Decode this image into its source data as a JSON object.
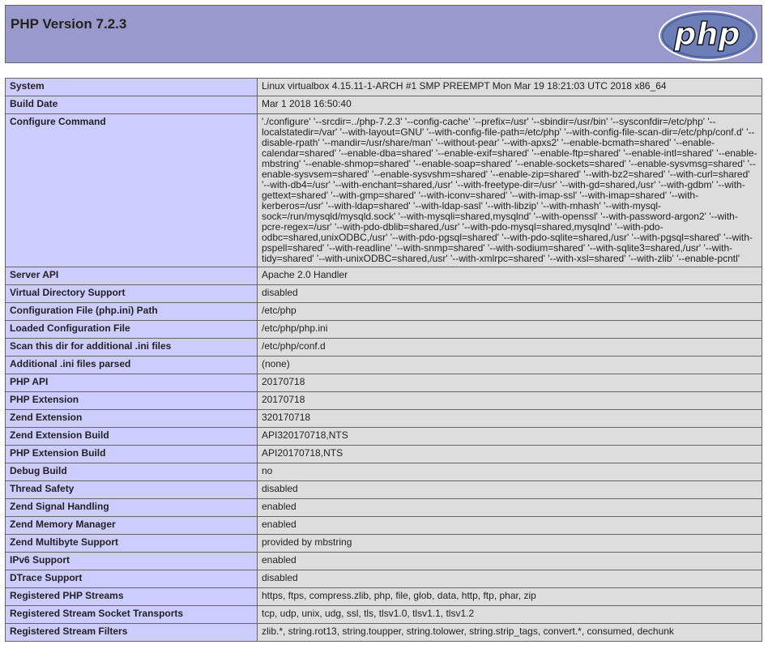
{
  "header": {
    "title": "PHP Version 7.2.3",
    "logo_text": "php"
  },
  "rows": [
    {
      "key": "System",
      "value": "Linux virtualbox 4.15.11-1-ARCH #1 SMP PREEMPT Mon Mar 19 18:21:03 UTC 2018 x86_64"
    },
    {
      "key": "Build Date",
      "value": "Mar 1 2018 16:50:40"
    },
    {
      "key": "Configure Command",
      "value": "'./configure' '--srcdir=../php-7.2.3' '--config-cache' '--prefix=/usr' '--sbindir=/usr/bin' '--sysconfdir=/etc/php' '--localstatedir=/var' '--with-layout=GNU' '--with-config-file-path=/etc/php' '--with-config-file-scan-dir=/etc/php/conf.d' '--disable-rpath' '--mandir=/usr/share/man' '--without-pear' '--with-apxs2' '--enable-bcmath=shared' '--enable-calendar=shared' '--enable-dba=shared' '--enable-exif=shared' '--enable-ftp=shared' '--enable-intl=shared' '--enable-mbstring' '--enable-shmop=shared' '--enable-soap=shared' '--enable-sockets=shared' '--enable-sysvmsg=shared' '--enable-sysvsem=shared' '--enable-sysvshm=shared' '--enable-zip=shared' '--with-bz2=shared' '--with-curl=shared' '--with-db4=/usr' '--with-enchant=shared,/usr' '--with-freetype-dir=/usr' '--with-gd=shared,/usr' '--with-gdbm' '--with-gettext=shared' '--with-gmp=shared' '--with-iconv=shared' '--with-imap-ssl' '--with-imap=shared' '--with-kerberos=/usr' '--with-ldap=shared' '--with-ldap-sasl' '--with-libzip' '--with-mhash' '--with-mysql-sock=/run/mysqld/mysqld.sock' '--with-mysqli=shared,mysqlnd' '--with-openssl' '--with-password-argon2' '--with-pcre-regex=/usr' '--with-pdo-dblib=shared,/usr' '--with-pdo-mysql=shared,mysqlnd' '--with-pdo-odbc=shared,unixODBC,/usr' '--with-pdo-pgsql=shared' '--with-pdo-sqlite=shared,/usr' '--with-pgsql=shared' '--with-pspell=shared' '--with-readline' '--with-snmp=shared' '--with-sodium=shared' '--with-sqlite3=shared,/usr' '--with-tidy=shared' '--with-unixODBC=shared,/usr' '--with-xmlrpc=shared' '--with-xsl=shared' '--with-zlib' '--enable-pcntl'"
    },
    {
      "key": "Server API",
      "value": "Apache 2.0 Handler"
    },
    {
      "key": "Virtual Directory Support",
      "value": "disabled"
    },
    {
      "key": "Configuration File (php.ini) Path",
      "value": "/etc/php"
    },
    {
      "key": "Loaded Configuration File",
      "value": "/etc/php/php.ini"
    },
    {
      "key": "Scan this dir for additional .ini files",
      "value": "/etc/php/conf.d"
    },
    {
      "key": "Additional .ini files parsed",
      "value": "(none)"
    },
    {
      "key": "PHP API",
      "value": "20170718"
    },
    {
      "key": "PHP Extension",
      "value": "20170718"
    },
    {
      "key": "Zend Extension",
      "value": "320170718"
    },
    {
      "key": "Zend Extension Build",
      "value": "API320170718,NTS"
    },
    {
      "key": "PHP Extension Build",
      "value": "API20170718,NTS"
    },
    {
      "key": "Debug Build",
      "value": "no"
    },
    {
      "key": "Thread Safety",
      "value": "disabled"
    },
    {
      "key": "Zend Signal Handling",
      "value": "enabled"
    },
    {
      "key": "Zend Memory Manager",
      "value": "enabled"
    },
    {
      "key": "Zend Multibyte Support",
      "value": "provided by mbstring"
    },
    {
      "key": "IPv6 Support",
      "value": "enabled"
    },
    {
      "key": "DTrace Support",
      "value": "disabled"
    },
    {
      "key": "Registered PHP Streams",
      "value": "https, ftps, compress.zlib, php, file, glob, data, http, ftp, phar, zip"
    },
    {
      "key": "Registered Stream Socket Transports",
      "value": "tcp, udp, unix, udg, ssl, tls, tlsv1.0, tlsv1.1, tlsv1.2"
    },
    {
      "key": "Registered Stream Filters",
      "value": "zlib.*, string.rot13, string.toupper, string.tolower, string.strip_tags, convert.*, consumed, dechunk"
    }
  ]
}
